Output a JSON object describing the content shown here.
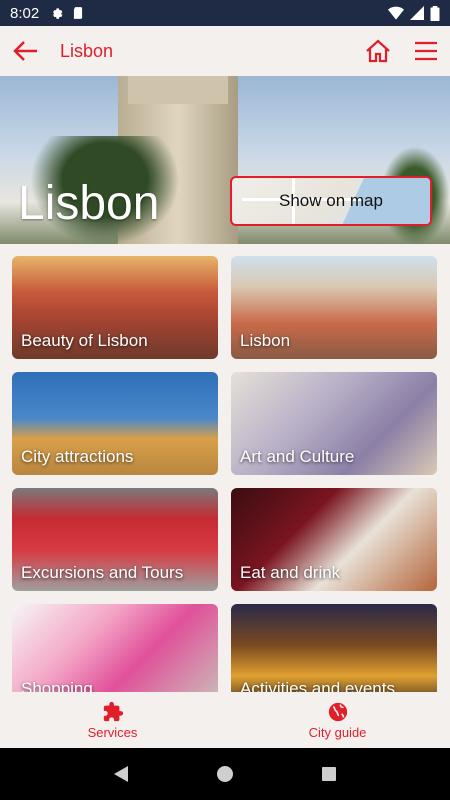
{
  "status_bar": {
    "time": "8:02"
  },
  "app_bar": {
    "title": "Lisbon"
  },
  "hero": {
    "title": "Lisbon",
    "map_button_label": "Show on map"
  },
  "tiles": [
    {
      "label": "Beauty of Lisbon"
    },
    {
      "label": "Lisbon"
    },
    {
      "label": "City attractions"
    },
    {
      "label": "Art and Culture"
    },
    {
      "label": "Excursions and Tours"
    },
    {
      "label": "Eat and drink"
    },
    {
      "label": "Shopping"
    },
    {
      "label": "Activities and events"
    }
  ],
  "bottom_nav": [
    {
      "label": "Services",
      "icon": "puzzle-icon"
    },
    {
      "label": "City guide",
      "icon": "globe-icon"
    }
  ],
  "colors": {
    "accent": "#e11f2b",
    "status_bar": "#1f2a44",
    "background": "#f3f0ee"
  }
}
